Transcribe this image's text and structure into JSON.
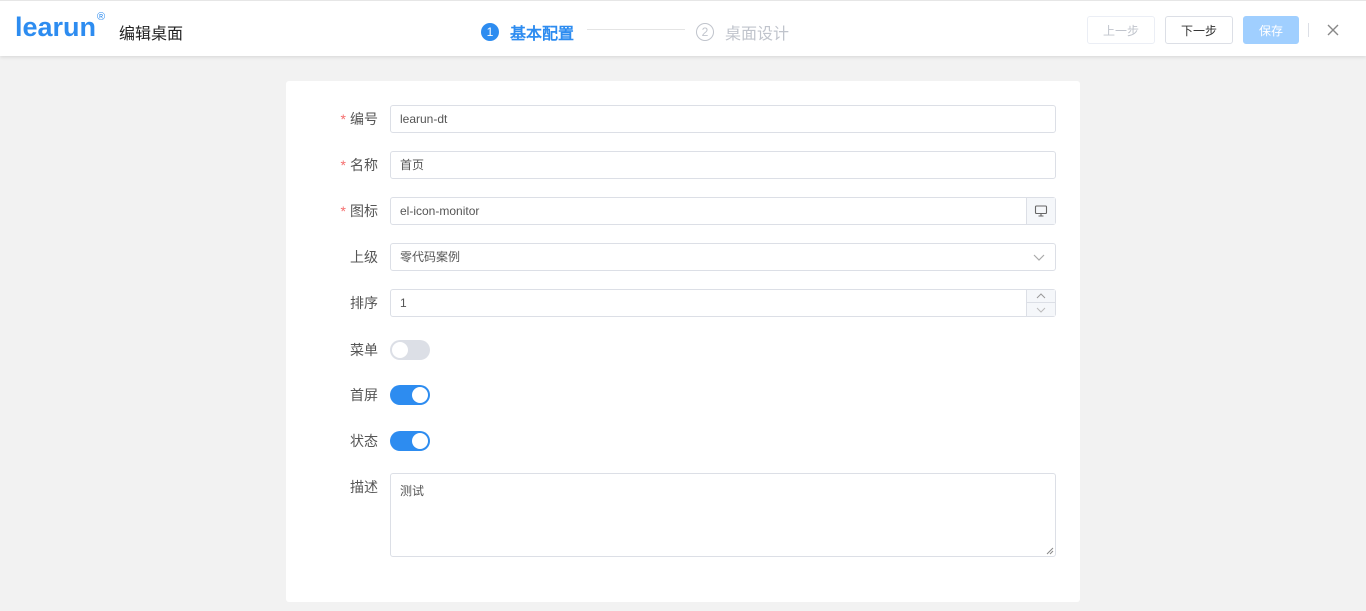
{
  "header": {
    "logo_text": "learun",
    "logo_mark": "®",
    "title": "编辑桌面",
    "steps": [
      {
        "number": "1",
        "label": "基本配置",
        "state": "active"
      },
      {
        "number": "2",
        "label": "桌面设计",
        "state": "pending"
      }
    ],
    "prev_label": "上一步",
    "next_label": "下一步",
    "save_label": "保存",
    "accent_color": "#2d8cf0"
  },
  "form": {
    "code": {
      "label": "编号",
      "required": true,
      "value": "learun-dt"
    },
    "name": {
      "label": "名称",
      "required": true,
      "value": "首页"
    },
    "icon": {
      "label": "图标",
      "required": true,
      "value": "el-icon-monitor",
      "button_icon": "monitor-icon"
    },
    "parent": {
      "label": "上级",
      "value": "零代码案例"
    },
    "sort": {
      "label": "排序",
      "value": "1"
    },
    "menu": {
      "label": "菜单",
      "on": false
    },
    "home_screen": {
      "label": "首屏",
      "on": true
    },
    "status": {
      "label": "状态",
      "on": true
    },
    "description": {
      "label": "描述",
      "value": "测试"
    }
  },
  "required_mark": "*"
}
